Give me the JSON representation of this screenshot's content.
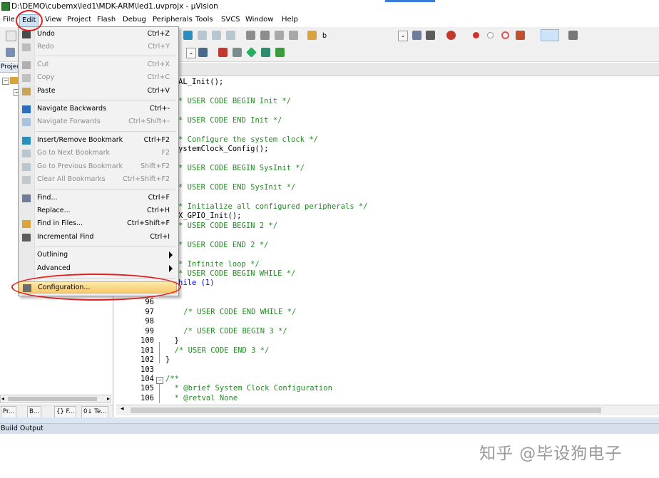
{
  "window": {
    "title": "D:\\DEMO\\cubemx\\led1\\MDK-ARM\\led1.uvprojx - µVision"
  },
  "menubar": {
    "items": [
      "File",
      "Edit",
      "View",
      "Project",
      "Flash",
      "Debug",
      "Peripherals",
      "Tools",
      "SVCS",
      "Window",
      "Help"
    ]
  },
  "toolbar": {
    "target_text": "b"
  },
  "left_panel": {
    "header": "Projec",
    "bottom_tabs": [
      "Pr...",
      "B...",
      "{} F...",
      "0↓ Te..."
    ]
  },
  "edit_menu": {
    "items": [
      {
        "label": "Undo",
        "shortcut": "Ctrl+Z",
        "enabled": true,
        "icon": "undo-icon"
      },
      {
        "label": "Redo",
        "shortcut": "Ctrl+Y",
        "enabled": false,
        "icon": "redo-icon"
      },
      {
        "label": "Cut",
        "shortcut": "Ctrl+X",
        "enabled": false,
        "icon": "cut-icon"
      },
      {
        "label": "Copy",
        "shortcut": "Ctrl+C",
        "enabled": false,
        "icon": "copy-icon"
      },
      {
        "label": "Paste",
        "shortcut": "Ctrl+V",
        "enabled": true,
        "icon": "paste-icon"
      },
      {
        "label": "Navigate Backwards",
        "shortcut": "Ctrl+-",
        "enabled": true,
        "icon": "back-arrow-icon"
      },
      {
        "label": "Navigate Forwards",
        "shortcut": "Ctrl+Shift+-",
        "enabled": false,
        "icon": "forward-arrow-icon"
      },
      {
        "label": "Insert/Remove Bookmark",
        "shortcut": "Ctrl+F2",
        "enabled": true,
        "icon": "bookmark-icon"
      },
      {
        "label": "Go to Next Bookmark",
        "shortcut": "F2",
        "enabled": false,
        "icon": "next-bookmark-icon"
      },
      {
        "label": "Go to Previous Bookmark",
        "shortcut": "Shift+F2",
        "enabled": false,
        "icon": "previous-bookmark-icon"
      },
      {
        "label": "Clear All Bookmarks",
        "shortcut": "Ctrl+Shift+F2",
        "enabled": false,
        "icon": "clear-bookmarks-icon"
      },
      {
        "label": "Find...",
        "shortcut": "Ctrl+F",
        "enabled": true,
        "icon": "find-icon"
      },
      {
        "label": "Replace...",
        "shortcut": "Ctrl+H",
        "enabled": true,
        "icon": ""
      },
      {
        "label": "Find in Files...",
        "shortcut": "Ctrl+Shift+F",
        "enabled": true,
        "icon": "find-in-files-icon"
      },
      {
        "label": "Incremental Find",
        "shortcut": "Ctrl+I",
        "enabled": true,
        "icon": "incremental-find-icon"
      },
      {
        "label": "Outlining",
        "shortcut": "",
        "enabled": true,
        "icon": "",
        "submenu": true
      },
      {
        "label": "Advanced",
        "shortcut": "",
        "enabled": true,
        "icon": "",
        "submenu": true
      },
      {
        "label": "Configuration...",
        "shortcut": "",
        "enabled": true,
        "icon": "wrench-icon",
        "highlighted": true
      }
    ]
  },
  "editor": {
    "lines": [
      {
        "num": "",
        "text": "AL_Init();",
        "kind": "code"
      },
      {
        "num": "",
        "text": "",
        "kind": "code"
      },
      {
        "num": "",
        "text": "* USER CODE BEGIN Init */",
        "kind": "comment"
      },
      {
        "num": "",
        "text": "",
        "kind": "code"
      },
      {
        "num": "",
        "text": "* USER CODE END Init */",
        "kind": "comment"
      },
      {
        "num": "",
        "text": "",
        "kind": "code"
      },
      {
        "num": "",
        "text": "* Configure the system clock */",
        "kind": "comment"
      },
      {
        "num": "",
        "text": "ystemClock_Config();",
        "kind": "code"
      },
      {
        "num": "",
        "text": "",
        "kind": "code"
      },
      {
        "num": "",
        "text": "* USER CODE BEGIN SysInit */",
        "kind": "comment"
      },
      {
        "num": "",
        "text": "",
        "kind": "code"
      },
      {
        "num": "",
        "text": "* USER CODE END SysInit */",
        "kind": "comment"
      },
      {
        "num": "",
        "text": "",
        "kind": "code"
      },
      {
        "num": "",
        "text": "* Initialize all configured peripherals */",
        "kind": "comment"
      },
      {
        "num": "",
        "text": "X_GPIO_Init();",
        "kind": "code"
      },
      {
        "num": "",
        "text": "* USER CODE BEGIN 2 */",
        "kind": "comment"
      },
      {
        "num": "",
        "text": "",
        "kind": "code"
      },
      {
        "num": "",
        "text": "* USER CODE END 2 */",
        "kind": "comment"
      },
      {
        "num": "",
        "text": "",
        "kind": "code"
      },
      {
        "num": "",
        "text": "* Infinite loop */",
        "kind": "comment"
      },
      {
        "num": "",
        "text": "* USER CODE BEGIN WHILE */",
        "kind": "comment"
      },
      {
        "num": "",
        "text": "hile (1)",
        "kind": "keyword"
      },
      {
        "num": "",
        "text": "",
        "kind": "code"
      },
      {
        "num": "96",
        "text": "",
        "kind": "code"
      },
      {
        "num": "97",
        "text": "    /* USER CODE END WHILE */",
        "kind": "comment"
      },
      {
        "num": "98",
        "text": "",
        "kind": "code"
      },
      {
        "num": "99",
        "text": "    /* USER CODE BEGIN 3 */",
        "kind": "comment"
      },
      {
        "num": "100",
        "text": "  }",
        "kind": "code"
      },
      {
        "num": "101",
        "text": "  /* USER CODE END 3 */",
        "kind": "comment"
      },
      {
        "num": "102",
        "text": "}",
        "kind": "code"
      },
      {
        "num": "103",
        "text": "",
        "kind": "code"
      },
      {
        "num": "104",
        "text": "/**",
        "kind": "comment"
      },
      {
        "num": "105",
        "text": "  * @brief System Clock Configuration",
        "kind": "comment"
      },
      {
        "num": "106",
        "text": "  * @retval None",
        "kind": "comment"
      }
    ]
  },
  "build_output": {
    "title": "Build Output"
  },
  "watermark": "知乎 @毕设狗电子",
  "colors": {
    "comment": "#228b22",
    "keyword": "#0000ff",
    "highlight_oval": "#e02020",
    "menu_hover": "#f7c86d"
  }
}
